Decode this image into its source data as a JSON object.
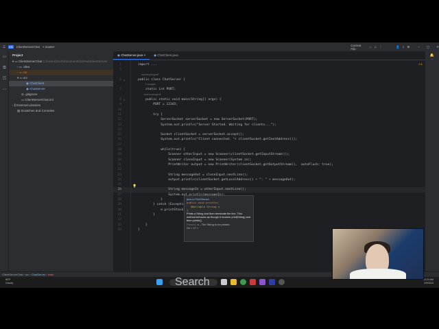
{
  "titlebar": {
    "project_badge": "CS",
    "project": "ClientServerChat",
    "branch": "master",
    "run_config": "Current File"
  },
  "project_panel": {
    "title": "Project",
    "items": [
      {
        "label": "ClientServerChat",
        "hint": "C:\\Users\\Zach\\Documents\\GitHub\\ClientServer"
      },
      {
        "label": ".idea"
      },
      {
        "label": "out"
      },
      {
        "label": "src"
      },
      {
        "label": "ChatClient"
      },
      {
        "label": "ChatServer"
      },
      {
        "label": ".gitignore"
      },
      {
        "label": "ClientServerChat.iml"
      },
      {
        "label": "External Libraries"
      },
      {
        "label": "Scratches and Consoles"
      }
    ]
  },
  "tabs": [
    {
      "label": "ChatServer.java"
    },
    {
      "label": "ChatClient.java"
    }
  ],
  "warnings": "⚠1",
  "code": [
    {
      "n": "1",
      "t": "import ..."
    },
    {
      "n": "5",
      "t": ""
    },
    {
      "n": "",
      "t": "     zacharybogroff",
      "inlay": true
    },
    {
      "n": "6",
      "t": "public class ChatServer {"
    },
    {
      "n": "",
      "t": "          2 usages",
      "inlay": true
    },
    {
      "n": "7",
      "t": "    static int PORT;"
    },
    {
      "n": "",
      "t": "        zacharybogroff",
      "inlay": true
    },
    {
      "n": "8",
      "t": "    public static void main(String[] args) {"
    },
    {
      "n": "9",
      "t": "        PORT = 12345;"
    },
    {
      "n": "10",
      "t": ""
    },
    {
      "n": "11",
      "t": "        try {"
    },
    {
      "n": "12",
      "t": "            ServerSocket serverSocket = new ServerSocket(PORT);"
    },
    {
      "n": "13",
      "t": "            System.out.println(\"Server Started. Waiting for clients...\");"
    },
    {
      "n": "14",
      "t": ""
    },
    {
      "n": "15",
      "t": "            Socket clientSocket = serverSocket.accept();"
    },
    {
      "n": "16",
      "t": "            System.out.println(\"Client connected: \"+ clientSocket.getInetAddress());"
    },
    {
      "n": "17",
      "t": ""
    },
    {
      "n": "18",
      "t": "            while(true) {"
    },
    {
      "n": "19",
      "t": "                Scanner otherInput = new Scanner(clientSocket.getInputStream());"
    },
    {
      "n": "20",
      "t": "                Scanner closeInput = new Scanner(System.in);"
    },
    {
      "n": "21",
      "t": "                PrintWriter output = new PrintWriter(clientSocket.getOutputStream(),  autoFlush: true);"
    },
    {
      "n": "22",
      "t": ""
    },
    {
      "n": "23",
      "t": "                String messageOut = closeInput.nextLine();"
    },
    {
      "n": "24",
      "t": "                output.println(clientSocket.getLocalAddress() + \": \" + messageOut);"
    },
    {
      "n": "25",
      "t": ""
    },
    {
      "n": "26",
      "t": "                String messageIn = otherInput.nextLine();",
      "cur": true
    },
    {
      "n": "27",
      "t": "                System.out.println(messageIn);"
    },
    {
      "n": "28",
      "t": "            }"
    },
    {
      "n": "29",
      "t": "        } catch (Exception e) {"
    },
    {
      "n": "30",
      "t": "            e.printStackTrace();"
    },
    {
      "n": "31",
      "t": "        }"
    },
    {
      "n": "32",
      "t": ""
    },
    {
      "n": "33",
      "t": "    }"
    },
    {
      "n": "34",
      "t": "}"
    }
  ],
  "tooltip": {
    "class": "java.io.PrintStream",
    "sig1": "public void println(",
    "sig2": "@Nullable  String x",
    "sig3": ")",
    "desc": "Prints a String and then terminate the line. This method behaves as though it invokes print(String) and then println().",
    "params_label": "Params:",
    "params": "x – The String to be printed.",
    "version": "On < 17 >"
  },
  "breadcrumb": [
    "ClientServerChat",
    "src",
    "ChatServer",
    "main"
  ],
  "taskbar": {
    "search": "Search",
    "weather_temp": "60°F",
    "weather_desc": "Cloudy",
    "time": "10:24 AM",
    "date": "2/9/2024"
  }
}
